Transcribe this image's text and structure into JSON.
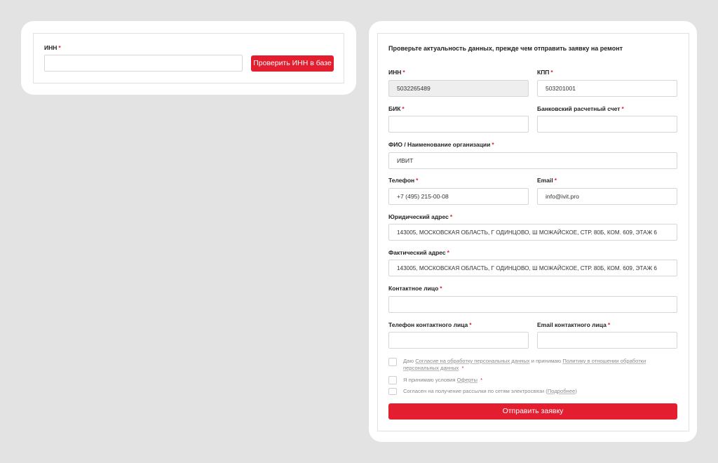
{
  "inn_check": {
    "inn_label": "ИНН",
    "inn_value": "",
    "check_button": "Проверить ИНН в базе"
  },
  "form": {
    "title": "Проверьте актуальность данных, прежде чем отправить заявку на ремонт",
    "required_mark": "*",
    "fields": {
      "inn": {
        "label": "ИНН",
        "value": "5032265489"
      },
      "kpp": {
        "label": "КПП",
        "value": "503201001"
      },
      "bik": {
        "label": "БИК",
        "value": ""
      },
      "bank_account": {
        "label": "Банковский расчетный счет",
        "value": ""
      },
      "org_name": {
        "label": "ФИО / Наименование организации",
        "value": "ИВИТ"
      },
      "phone": {
        "label": "Телефон",
        "value": "+7 (495) 215-00-08"
      },
      "email": {
        "label": "Email",
        "value": "info@ivit.pro"
      },
      "legal_address": {
        "label": "Юридический адрес",
        "value": "143005, МОСКОВСКАЯ ОБЛАСТЬ, Г ОДИНЦОВО, Ш МОЖАЙСКОЕ, СТР. 80Б, КОМ. 609, ЭТАЖ 6"
      },
      "actual_address": {
        "label": "Фактический адрес",
        "value": "143005, МОСКОВСКАЯ ОБЛАСТЬ, Г ОДИНЦОВО, Ш МОЖАЙСКОЕ, СТР. 80Б, КОМ. 609, ЭТАЖ 6"
      },
      "contact_person": {
        "label": "Контактное лицо",
        "value": ""
      },
      "contact_phone": {
        "label": "Телефон контактного лица",
        "value": ""
      },
      "contact_email": {
        "label": "Email контактного лица",
        "value": ""
      }
    },
    "consents": {
      "c1_prefix": "Даю",
      "c1_link1": "Согласие на обработку персональных данных",
      "c1_middle": "и принимаю",
      "c1_link2": "Политику в отношении обработки персональных данных",
      "c2_prefix": "Я принимаю условия",
      "c2_link": "Оферты",
      "c3_text": "Согласен на получение рассылки по сетям электросвязи",
      "c3_link": "Подробнее"
    },
    "submit_button": "Отправить заявку",
    "colors": {
      "accent": "#e31e2e",
      "page_bg": "#e3e3e3"
    }
  }
}
